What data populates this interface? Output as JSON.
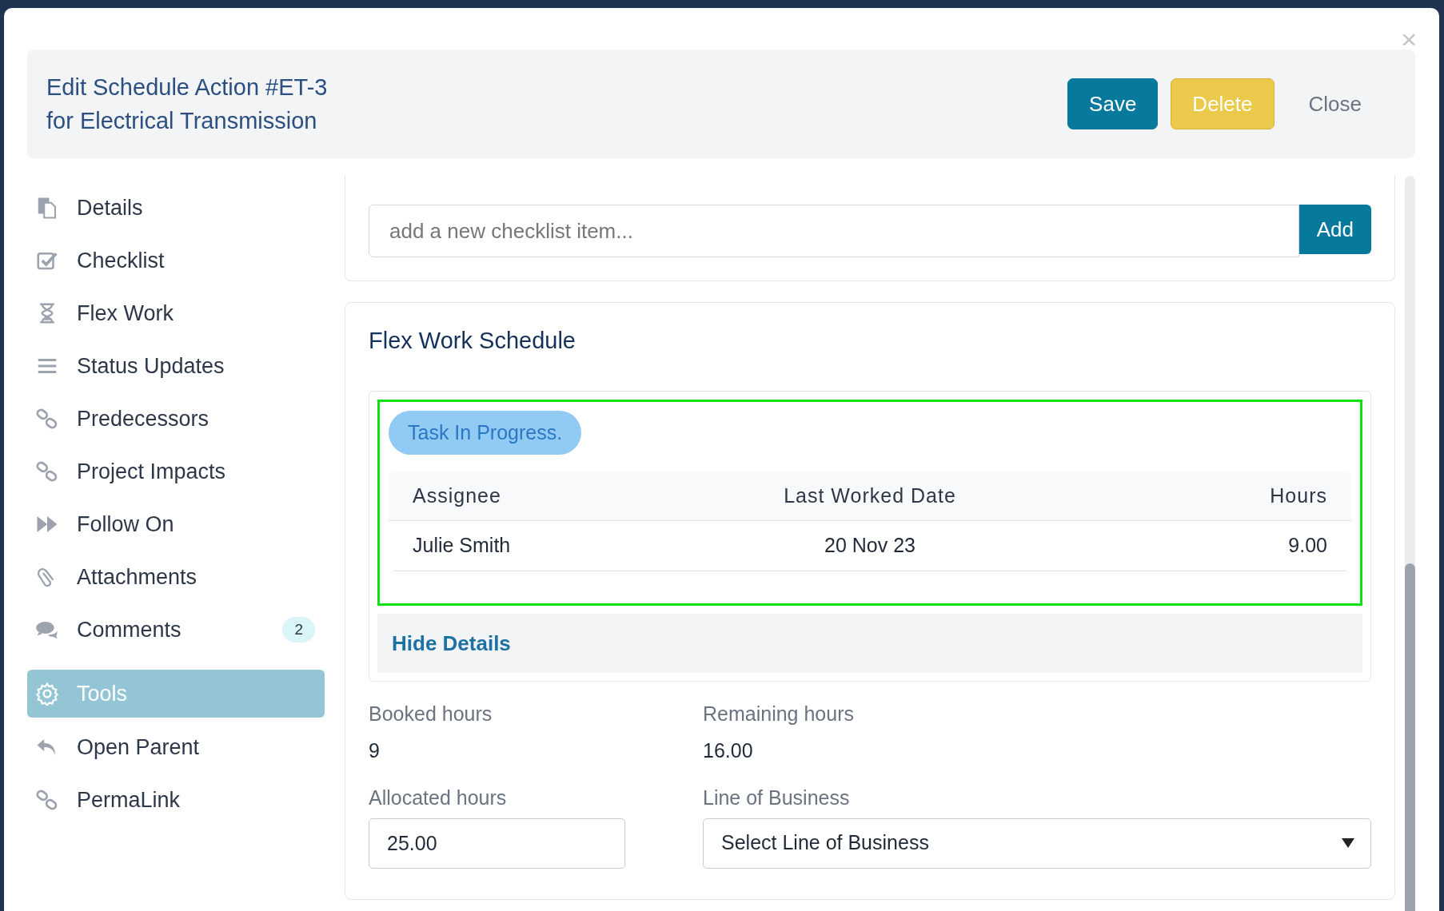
{
  "modal": {
    "title_line_1": "Edit Schedule Action #ET-3",
    "title_line_2": "for Electrical Transmission",
    "close_icon": "×"
  },
  "header_buttons": [
    {
      "kind": "primary",
      "label": "Save"
    },
    {
      "kind": "warning",
      "label": "Delete"
    },
    {
      "kind": "plain",
      "label": "Close"
    }
  ],
  "sidebar": {
    "items": [
      {
        "label": "Details",
        "selected": false
      },
      {
        "label": "Checklist",
        "selected": false
      },
      {
        "label": "Flex Work",
        "selected": false
      },
      {
        "label": "Status Updates",
        "selected": false
      },
      {
        "label": "Predecessors",
        "selected": false
      },
      {
        "label": "Project Impacts",
        "selected": false
      },
      {
        "label": "Follow On",
        "selected": false
      },
      {
        "label": "Attachments",
        "selected": false
      },
      {
        "label": "Comments",
        "selected": false,
        "badge": "2"
      },
      {
        "label": "Tools",
        "selected": true
      },
      {
        "label": "Open Parent",
        "selected": false
      },
      {
        "label": "PermaLink",
        "selected": false
      }
    ]
  },
  "checklist": {
    "placeholder": "add a new checklist item...",
    "add_button": "Add"
  },
  "flex_work": {
    "title": "Flex Work Schedule",
    "status_badge": "Task In Progress.",
    "table": {
      "columns": [
        "Assignee",
        "Last Worked Date",
        "Hours"
      ],
      "rows": [
        [
          "Julie Smith",
          "20 Nov 23",
          "9.00"
        ]
      ]
    },
    "toggle_link": "Hide Details",
    "booked_label": "Booked hours",
    "booked_value": "9",
    "remaining_label": "Remaining hours",
    "remaining_value": "16.00",
    "allocated_label": "Allocated hours",
    "allocated_value": "25.00",
    "lob_label": "Line of Business",
    "lob_value": "Select Line of Business"
  }
}
